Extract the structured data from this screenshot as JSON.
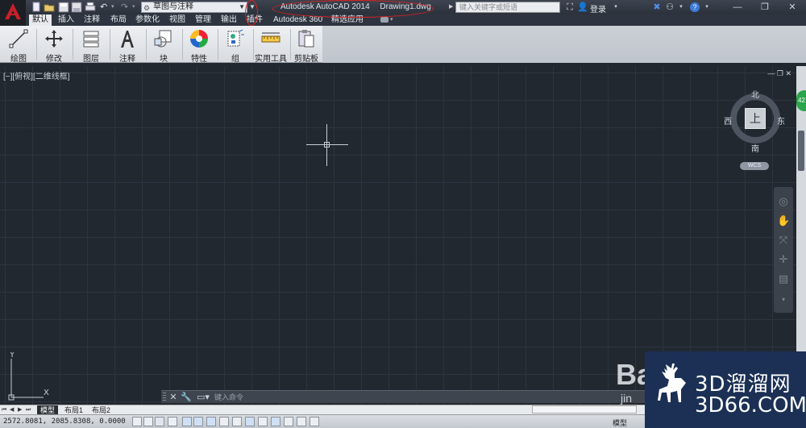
{
  "titlebar": {
    "workspace": "草图与注释",
    "app_name": "Autodesk AutoCAD 2014",
    "file_name": "Drawing1.dwg",
    "search_placeholder": "键入关键字或短语",
    "login": "登录"
  },
  "ribbon": {
    "tabs": [
      {
        "label": "默认",
        "active": true
      },
      {
        "label": "插入"
      },
      {
        "label": "注释"
      },
      {
        "label": "布局"
      },
      {
        "label": "参数化"
      },
      {
        "label": "视图"
      },
      {
        "label": "管理"
      },
      {
        "label": "输出"
      },
      {
        "label": "插件"
      },
      {
        "label": "Autodesk 360"
      },
      {
        "label": "精选应用"
      }
    ],
    "panels": [
      {
        "label": "绘图",
        "icon": "draw-line-icon"
      },
      {
        "label": "修改",
        "icon": "move-icon"
      },
      {
        "label": "图层",
        "icon": "layers-icon"
      },
      {
        "label": "注释",
        "icon": "text-icon"
      },
      {
        "label": "块",
        "icon": "block-icon"
      },
      {
        "label": "特性",
        "icon": "color-wheel-icon"
      },
      {
        "label": "组",
        "icon": "group-icon"
      },
      {
        "label": "实用工具",
        "icon": "measure-icon"
      },
      {
        "label": "剪贴板",
        "icon": "clipboard-icon"
      }
    ]
  },
  "viewport": {
    "label": "[−][俯视][二维线框]",
    "viewcube": {
      "top": "上",
      "north": "北",
      "south": "南",
      "east": "东",
      "west": "西"
    },
    "wcs": "WCS"
  },
  "commandline": {
    "placeholder": "键入命令"
  },
  "layout_tabs": [
    {
      "label": "模型",
      "active": true
    },
    {
      "label": "布局1"
    },
    {
      "label": "布局2"
    }
  ],
  "statusbar": {
    "coords": "2572.8081, 2085.8308, 0.0000",
    "model": "模型"
  },
  "watermark": {
    "brand": "3D溜溜网",
    "domain": "3D66.COM",
    "baidu": "Ba",
    "baidu_sub": "jin"
  },
  "badge": "42",
  "colors": {
    "canvas_bg": "#212830",
    "grid": "#2c3540",
    "annotation": "#e02020",
    "brand_red": "#c8202a"
  }
}
